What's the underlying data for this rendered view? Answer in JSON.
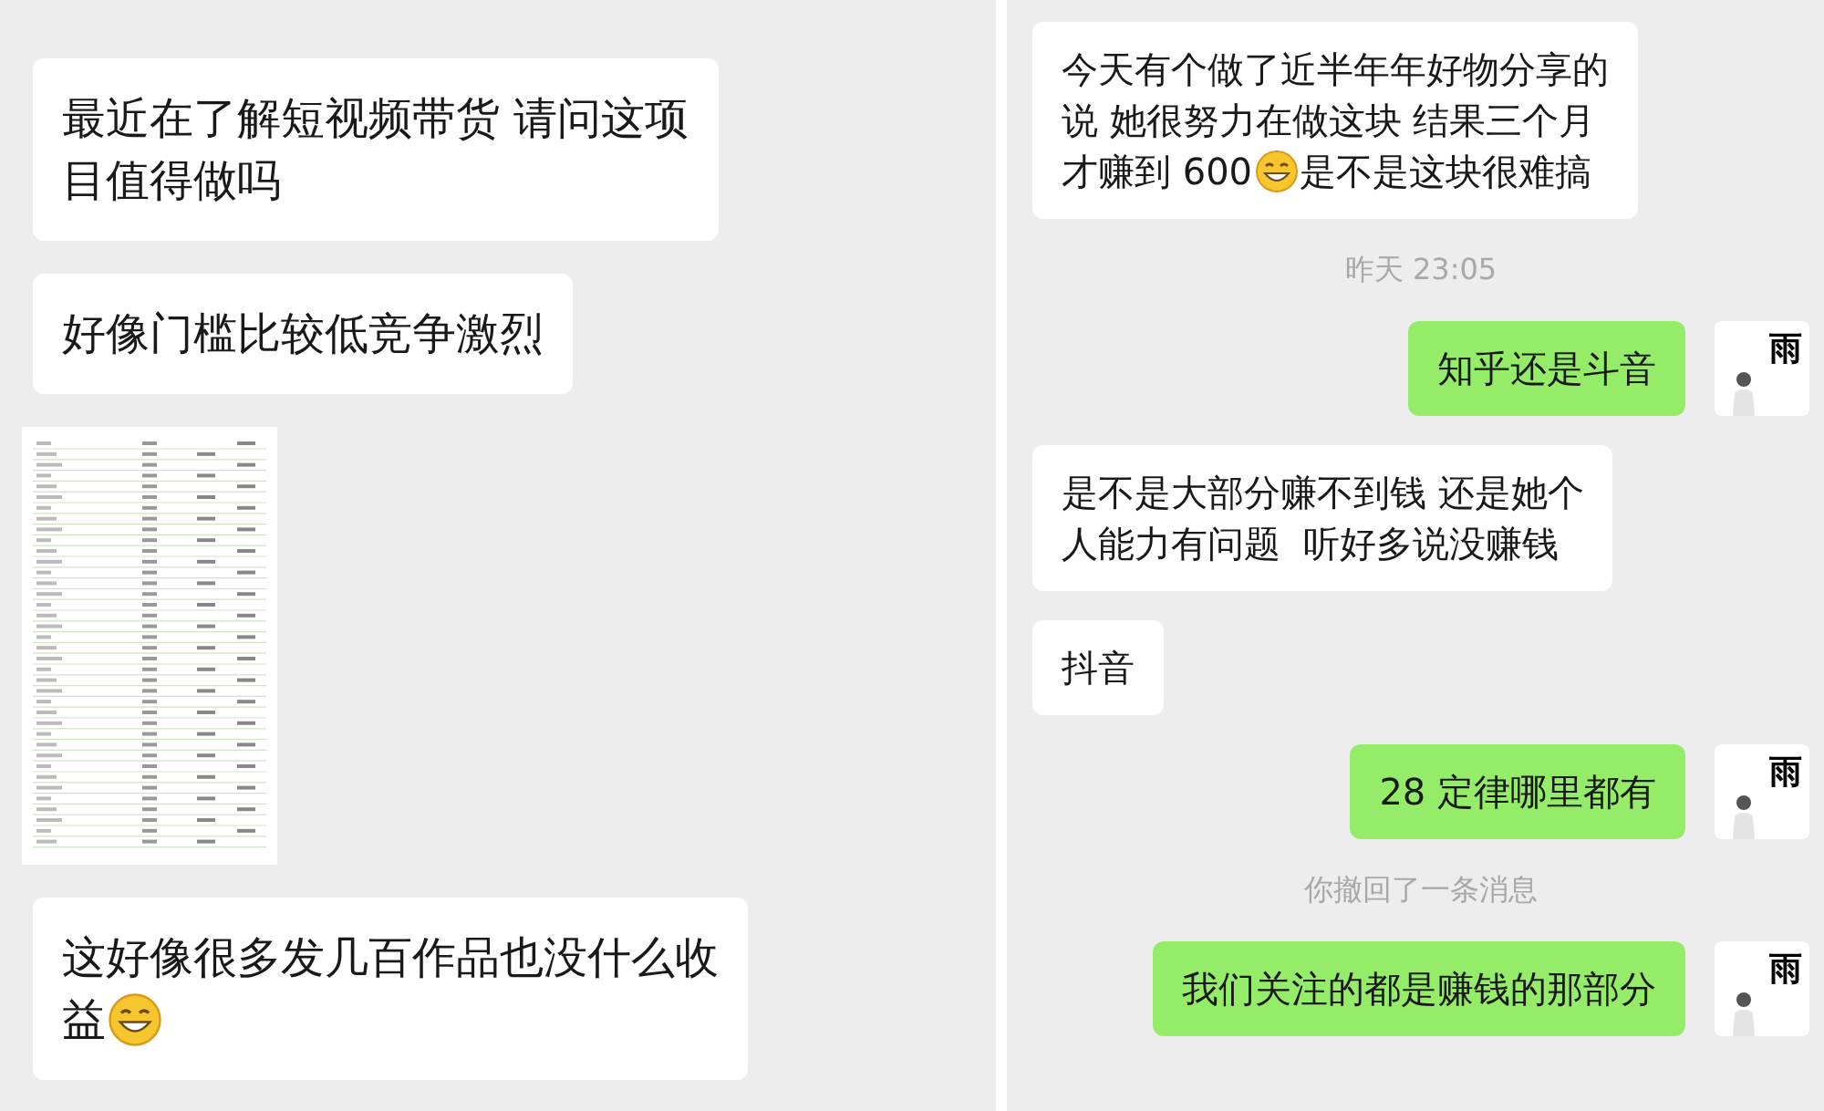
{
  "left_chat": {
    "messages": [
      {
        "kind": "received",
        "lines": [
          [
            {
              "kind": "text",
              "text": "最近在了解短视频带货 请问这项"
            }
          ],
          [
            {
              "kind": "text",
              "text": "目值得做吗"
            }
          ]
        ]
      },
      {
        "kind": "received",
        "lines": [
          [
            {
              "kind": "text",
              "text": "好像门槛比较低竞争激烈"
            }
          ]
        ]
      },
      {
        "kind": "image"
      },
      {
        "kind": "received",
        "lines": [
          [
            {
              "kind": "text",
              "text": "这好像很多发几百作品也没什么收"
            }
          ],
          [
            {
              "kind": "text",
              "text": "益"
            },
            {
              "kind": "emoji"
            }
          ]
        ]
      }
    ]
  },
  "right_chat": {
    "messages": [
      {
        "kind": "received",
        "lines": [
          [
            {
              "kind": "text",
              "text": "今天有个做了近半年年好物分享的"
            }
          ],
          [
            {
              "kind": "text",
              "text": "说 她很努力在做这块 结果三个月"
            }
          ],
          [
            {
              "kind": "text",
              "text": "才赚到 600"
            },
            {
              "kind": "emoji"
            },
            {
              "kind": "text",
              "text": "是不是这块很难搞"
            }
          ]
        ]
      },
      {
        "kind": "time",
        "text": "昨天 23:05"
      },
      {
        "kind": "sent",
        "avatar": "雨",
        "lines": [
          [
            {
              "kind": "text",
              "text": "知乎还是斗音"
            }
          ]
        ]
      },
      {
        "kind": "received",
        "lines": [
          [
            {
              "kind": "text",
              "text": "是不是大部分赚不到钱 还是她个"
            }
          ],
          [
            {
              "kind": "text",
              "text": "人能力有问题  听好多说没赚钱"
            }
          ]
        ]
      },
      {
        "kind": "received",
        "lines": [
          [
            {
              "kind": "text",
              "text": "抖音"
            }
          ]
        ]
      },
      {
        "kind": "sent",
        "avatar": "雨",
        "lines": [
          [
            {
              "kind": "text",
              "text": "28 定律哪里都有"
            }
          ]
        ]
      },
      {
        "kind": "notice",
        "text": "你撤回了一条消息"
      },
      {
        "kind": "sent",
        "avatar": "雨",
        "lines": [
          [
            {
              "kind": "text",
              "text": "我们关注的都是赚钱的那部分"
            }
          ]
        ]
      }
    ]
  }
}
